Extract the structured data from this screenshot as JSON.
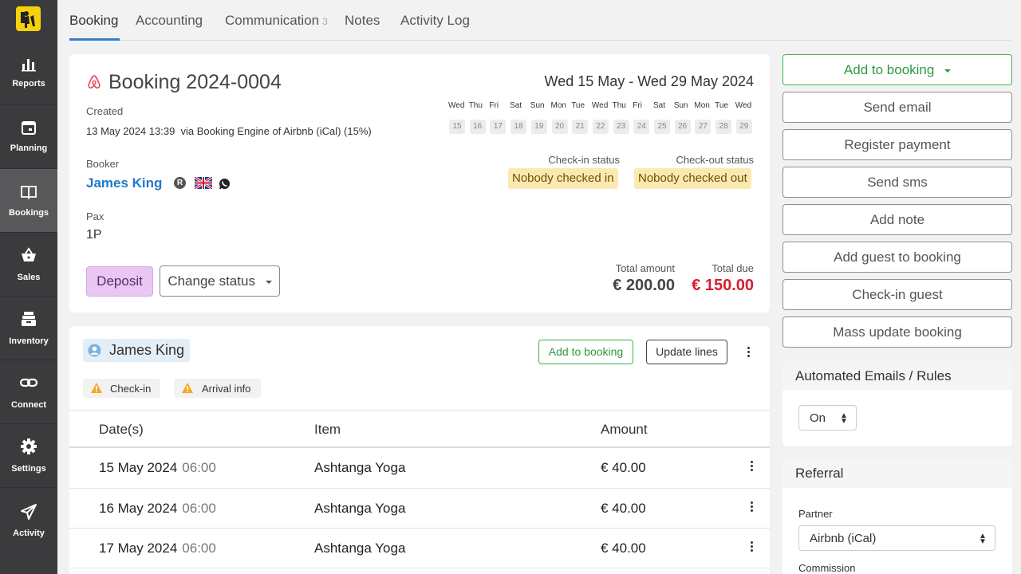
{
  "sidebar": {
    "items": [
      {
        "label": "Reports",
        "icon": "bar-chart-icon"
      },
      {
        "label": "Planning",
        "icon": "calendar-icon"
      },
      {
        "label": "Bookings",
        "icon": "book-icon"
      },
      {
        "label": "Sales",
        "icon": "basket-icon"
      },
      {
        "label": "Inventory",
        "icon": "inbox-icon"
      },
      {
        "label": "Connect",
        "icon": "link-icon"
      },
      {
        "label": "Settings",
        "icon": "gear-icon"
      },
      {
        "label": "Activity",
        "icon": "paper-plane-icon"
      }
    ]
  },
  "tabs": {
    "booking": "Booking",
    "accounting": "Accounting",
    "communication": "Communication",
    "communication_count": "3",
    "notes": "Notes",
    "activity_log": "Activity Log"
  },
  "booking": {
    "title": "Booking 2024-0004",
    "created_label": "Created",
    "created_value": "13 May 2024 13:39  via Booking Engine of Airbnb (iCal) (15%)",
    "date_range": "Wed 15 May - Wed 29 May 2024",
    "calendar": {
      "days": [
        "Wed",
        "Thu",
        "Fri",
        "Sat",
        "Sun",
        "Mon",
        "Tue",
        "Wed",
        "Thu",
        "Fri",
        "Sat",
        "Sun",
        "Mon",
        "Tue",
        "Wed"
      ],
      "dates": [
        "15",
        "16",
        "17",
        "18",
        "19",
        "20",
        "21",
        "22",
        "23",
        "24",
        "25",
        "26",
        "27",
        "28",
        "29"
      ]
    },
    "booker_label": "Booker",
    "booker_name": "James King",
    "booker_badge": "R",
    "checkin_status_label": "Check-in status",
    "checkin_status": "Nobody checked in",
    "checkout_status_label": "Check-out status",
    "checkout_status": "Nobody checked out",
    "pax_label": "Pax",
    "pax_value": "1P",
    "deposit_label": "Deposit",
    "change_status_label": "Change status",
    "total_amount_label": "Total amount",
    "total_amount": "€ 200.00",
    "total_due_label": "Total due",
    "total_due": "€ 150.00"
  },
  "guest": {
    "name": "James King",
    "add_to_booking": "Add to booking",
    "update_lines": "Update lines",
    "warnings": [
      "Check-in",
      "Arrival info"
    ],
    "columns": [
      "Date(s)",
      "Item",
      "Amount"
    ],
    "rows": [
      {
        "date": "15 May 2024",
        "time": "06:00",
        "item": "Ashtanga Yoga",
        "amount": "€ 40.00"
      },
      {
        "date": "16 May 2024",
        "time": "06:00",
        "item": "Ashtanga Yoga",
        "amount": "€ 40.00"
      },
      {
        "date": "17 May 2024",
        "time": "06:00",
        "item": "Ashtanga Yoga",
        "amount": "€ 40.00"
      }
    ]
  },
  "actions": {
    "add_to_booking": "Add to booking",
    "send_email": "Send email",
    "register_payment": "Register payment",
    "send_sms": "Send sms",
    "add_note": "Add note",
    "add_guest": "Add guest to booking",
    "checkin_guest": "Check-in guest",
    "mass_update": "Mass update booking"
  },
  "automated": {
    "title": "Automated Emails / Rules",
    "value": "On"
  },
  "referral": {
    "title": "Referral",
    "partner_label": "Partner",
    "partner_value": "Airbnb (iCal)",
    "commission_label": "Commission"
  },
  "colors": {
    "accent": "#2f7fc9",
    "link": "#1f78c8",
    "due": "#d61f2c",
    "green": "#2e9a3d",
    "deposit_bg": "#e9c7f3",
    "sidebar_bg": "#3b3b3d",
    "warning": "#f5a623"
  }
}
